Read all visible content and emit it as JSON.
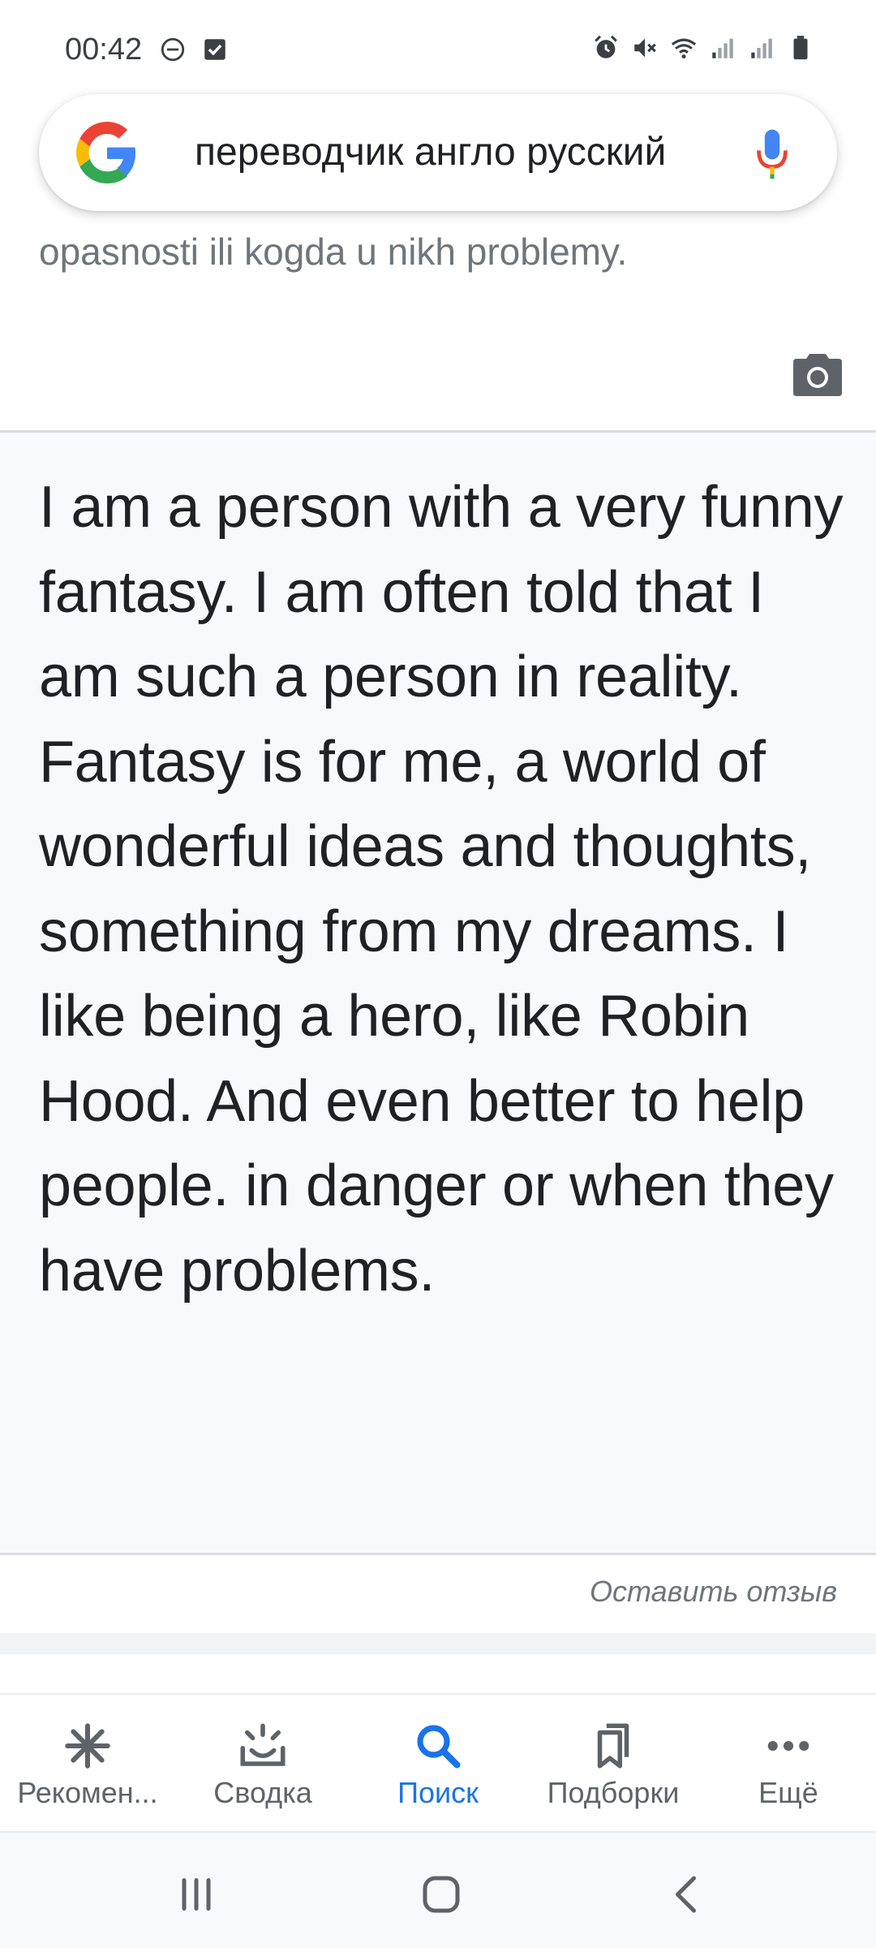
{
  "status_bar": {
    "time": "00:42",
    "left_icons": [
      "do-not-disturb-icon",
      "check-notification-icon"
    ],
    "right_icons": [
      "alarm-icon",
      "mute-icon",
      "wifi-icon",
      "signal-icon",
      "signal-icon",
      "battery-icon"
    ]
  },
  "search": {
    "query": "переводчик англо русский"
  },
  "source": {
    "tail_text": "opasnosti ili kogda u nikh problemy."
  },
  "translation": {
    "text": "I am a person with a very funny fantasy. I am often told that I am such a person in reality. Fantasy is for me, a world of wonderful ideas and thoughts, something from my dreams. I like being a hero, like Robin Hood. And even better to help people. in danger or when they have problems."
  },
  "feedback": {
    "label": "Оставить отзыв"
  },
  "bottom_nav": {
    "items": [
      {
        "label": "Рекомен...",
        "icon": "asterisk-icon"
      },
      {
        "label": "Сводка",
        "icon": "sunrise-icon"
      },
      {
        "label": "Поиск",
        "icon": "search-icon",
        "active": true
      },
      {
        "label": "Подборки",
        "icon": "collections-icon"
      },
      {
        "label": "Ещё",
        "icon": "more-icon"
      }
    ]
  },
  "colors": {
    "accent": "#1a73e8",
    "panel_bg": "#f8f9fa"
  }
}
